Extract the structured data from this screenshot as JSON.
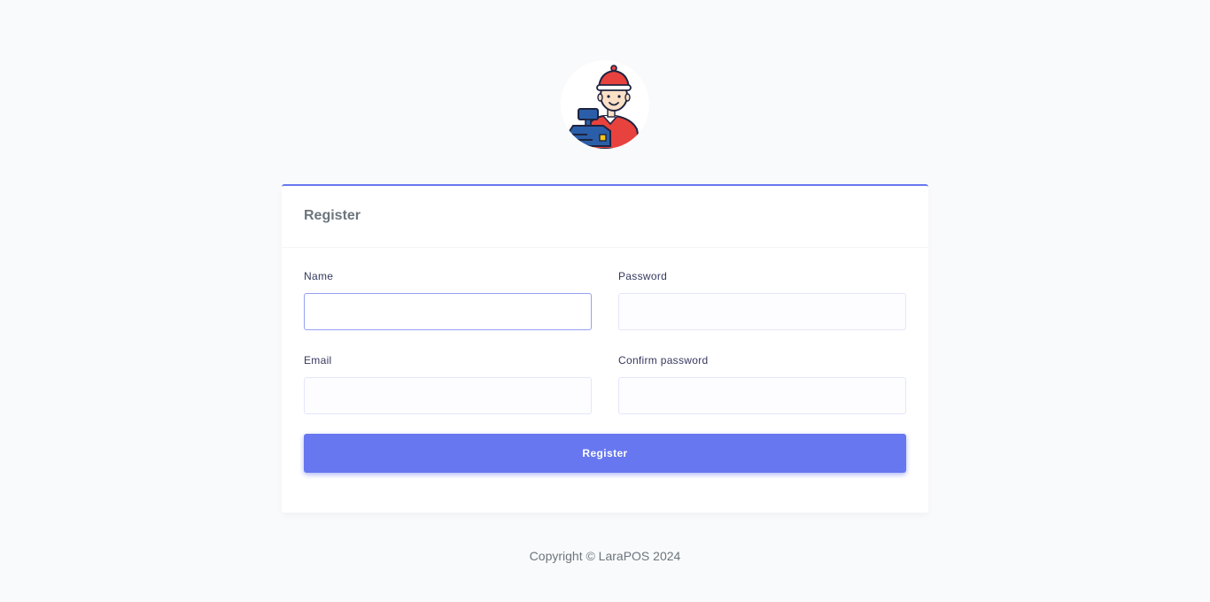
{
  "brand": {
    "logo_icon": "cashier-avatar-icon",
    "accent_color": "#6777ef"
  },
  "card": {
    "title": "Register"
  },
  "form": {
    "name": {
      "label": "Name",
      "value": ""
    },
    "password": {
      "label": "Password",
      "value": ""
    },
    "email": {
      "label": "Email",
      "value": ""
    },
    "confirm_password": {
      "label": "Confirm password",
      "value": ""
    },
    "submit_label": "Register"
  },
  "footer": {
    "copyright": "Copyright © LaraPOS 2024"
  }
}
